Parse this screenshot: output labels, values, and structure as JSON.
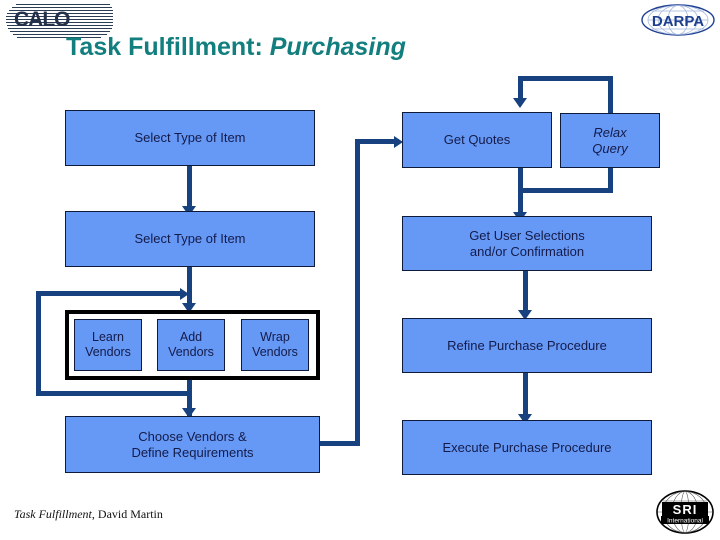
{
  "slide": {
    "title_main": "Task Fulfillment:",
    "title_emphasis": "Purchasing",
    "footer_title": "Task Fulfillment",
    "footer_rest": ", David Martin",
    "calo_logo_text": "CALO",
    "darpa_logo_text": "DARPA",
    "sri_logo_text": "SRI",
    "sri_logo_subtext": "International",
    "accent_color": "#127e7e",
    "node_fill_color": "#6699f5",
    "node_border_color": "#0d1a3a",
    "connector_color": "#17417f"
  },
  "nodes": {
    "select_type_1": "Select Type of Item",
    "select_type_2": "Select Type of Item",
    "learn_vendors": "Learn\nVendors",
    "learn_vendors_l1": "Learn",
    "learn_vendors_l2": "Vendors",
    "add_vendors_l1": "Add",
    "add_vendors_l2": "Vendors",
    "wrap_vendors_l1": "Wrap",
    "wrap_vendors_l2": "Vendors",
    "choose_vendors_l1": "Choose Vendors &",
    "choose_vendors_l2": "Define Requirements",
    "get_quotes": "Get Quotes",
    "relax_query_l1": "Relax",
    "relax_query_l2": "Query",
    "get_user_selections_l1": "Get User Selections",
    "get_user_selections_l2": "and/or Confirmation",
    "refine_purchase": "Refine Purchase Procedure",
    "execute_purchase": "Execute Purchase Procedure"
  }
}
